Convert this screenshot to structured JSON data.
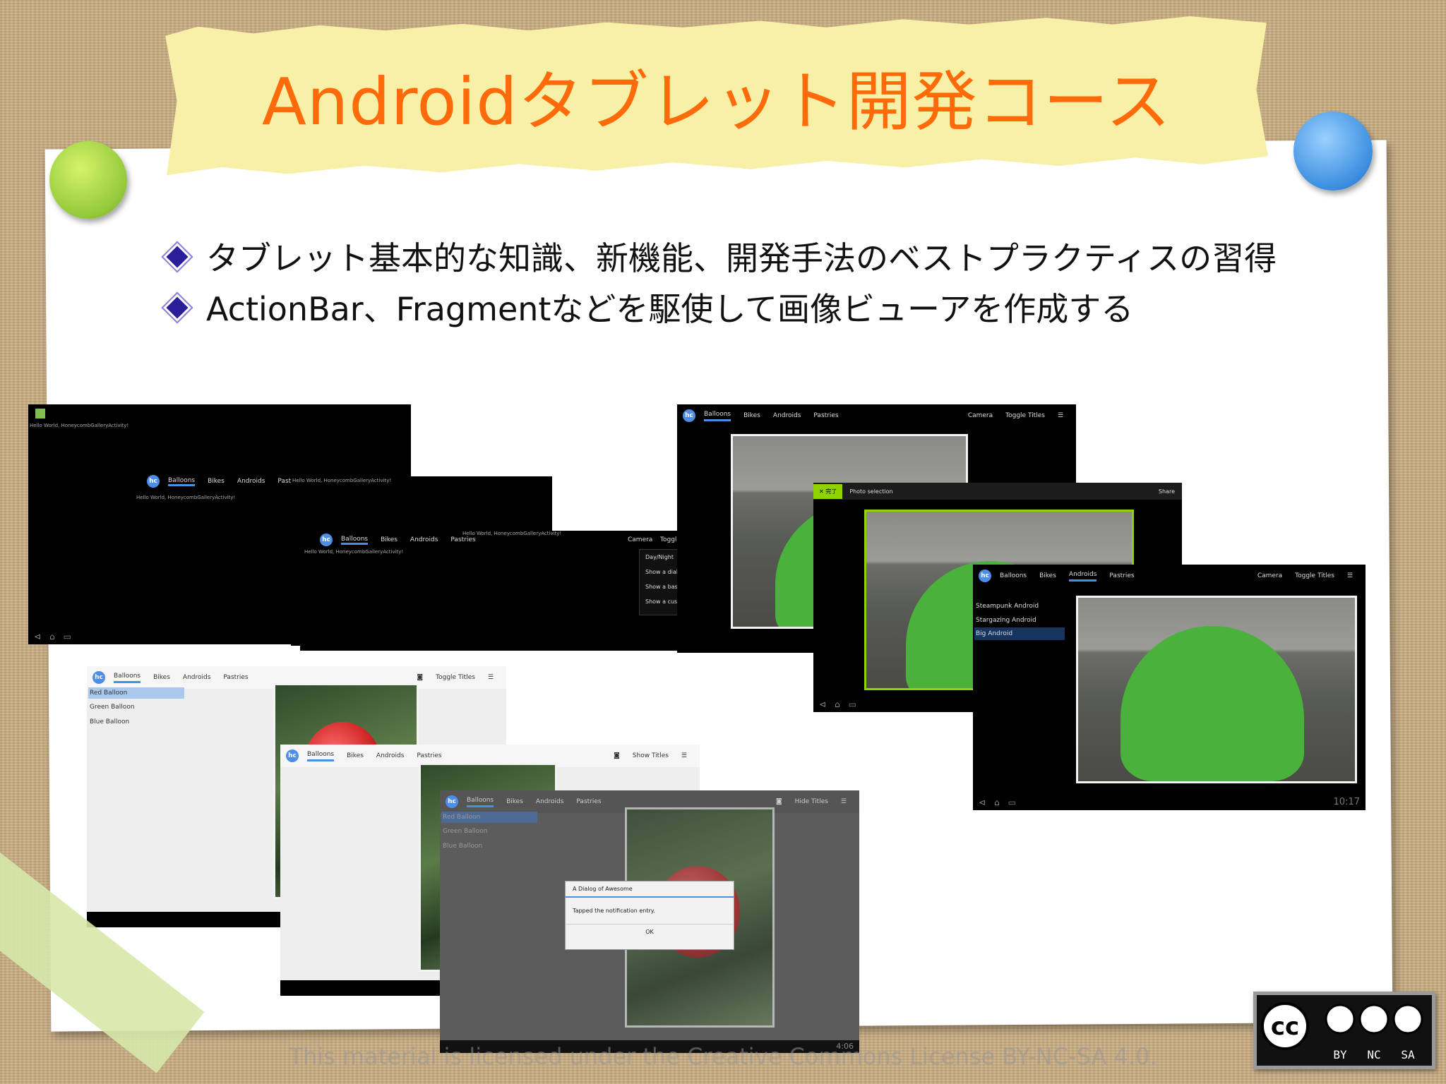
{
  "title": "Androidタブレット開発コース",
  "bullets": [
    "タブレット基本的な知識、新機能、開発手法のベストプラクティスの習得",
    "ActionBar、Fragmentなどを駆使して画像ビューアを作成する"
  ],
  "screens": {
    "hello_text": "Hello World, HoneycombGalleryActivity!",
    "hc_logo": "hc",
    "tabs": [
      "Balloons",
      "Bikes",
      "Androids",
      "Pastries"
    ],
    "camera_label": "Camera",
    "toggle_titles": "Toggle Titles",
    "toggle_short": "Toggle",
    "show_titles": "Show Titles",
    "hide_titles": "Hide Titles",
    "menu_items": [
      "Day/Night",
      "Show a dial",
      "Show a basi",
      "Show a cust"
    ],
    "balloon_list": [
      "Red Balloon",
      "Green Balloon",
      "Blue Balloon"
    ],
    "android_list": [
      "Steampunk Android",
      "Stargazing Android",
      "Big Android"
    ],
    "done_label": "完了",
    "photo_selection": "Photo selection",
    "share_label": "Share",
    "dialog_title": "A Dialog of Awesome",
    "dialog_message": "Tapped the notification entry.",
    "dialog_ok": "OK",
    "time_a": "10:17",
    "time_b": "4:06"
  },
  "license_text": "This material is licensed under the Creative Commons License BY-NC-SA 4.0.",
  "cc_badge": {
    "labels": [
      "BY",
      "NC",
      "SA"
    ]
  },
  "colors": {
    "title": "#ff6a0a",
    "bullet_diamond": "#2b1e9a",
    "tab_underline": "#4a8fe0",
    "cab_green": "#8fd400"
  }
}
